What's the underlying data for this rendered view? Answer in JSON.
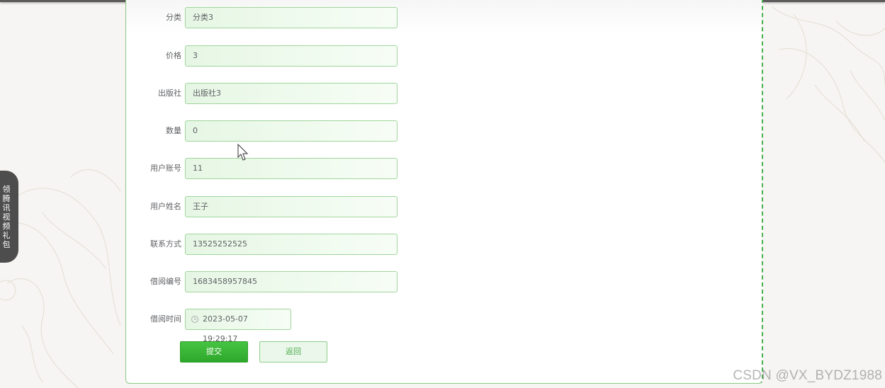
{
  "form": {
    "fields": [
      {
        "label": "分类",
        "value": "分类3"
      },
      {
        "label": "价格",
        "value": "3"
      },
      {
        "label": "出版社",
        "value": "出版社3"
      },
      {
        "label": "数量",
        "value": "0"
      },
      {
        "label": "用户账号",
        "value": "11"
      },
      {
        "label": "用户姓名",
        "value": "王子"
      },
      {
        "label": "联系方式",
        "value": "13525252525"
      },
      {
        "label": "借阅编号",
        "value": "1683458957845"
      }
    ],
    "borrow_time": {
      "label": "借阅时间",
      "value": "2023-05-07 19:29:17",
      "icon": "clock-icon"
    },
    "submit_label": "提交",
    "back_label": "返回"
  },
  "side_tab": {
    "text": "领腾讯视频礼包"
  },
  "watermark": "CSDN @VX_BYDZ1988",
  "colors": {
    "accent": "#2ea72b",
    "field_border": "#9fd69a",
    "field_bg": "#e6f6e4",
    "panel_border": "#4caf50"
  }
}
